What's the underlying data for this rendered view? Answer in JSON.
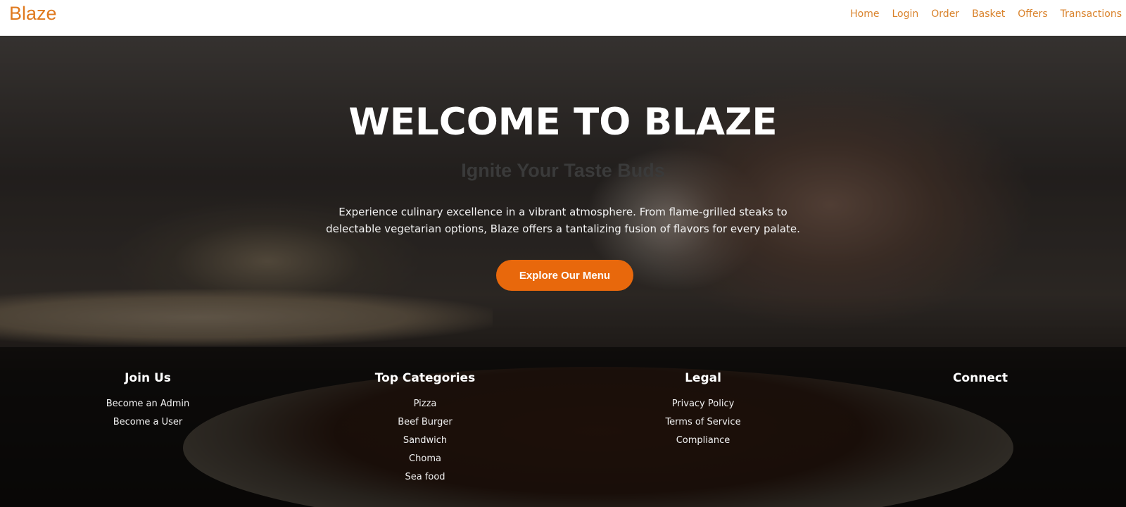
{
  "header": {
    "brand": "Blaze",
    "nav": [
      "Home",
      "Login",
      "Order",
      "Basket",
      "Offers",
      "Transactions"
    ]
  },
  "hero": {
    "title": "WELCOME TO BLAZE",
    "subtitle": "Ignite Your Taste Buds",
    "description": "Experience culinary excellence in a vibrant atmosphere. From flame-grilled steaks to delectable vegetarian options, Blaze offers a tantalizing fusion of flavors for every palate.",
    "cta": "Explore Our Menu"
  },
  "footer": {
    "join": {
      "heading": "Join Us",
      "links": [
        "Become an Admin",
        "Become a User"
      ]
    },
    "categories": {
      "heading": "Top Categories",
      "links": [
        "Pizza",
        "Beef Burger",
        "Sandwich",
        "Choma",
        "Sea food"
      ]
    },
    "legal": {
      "heading": "Legal",
      "links": [
        "Privacy Policy",
        "Terms of Service",
        "Compliance"
      ]
    },
    "connect": {
      "heading": "Connect"
    }
  },
  "colors": {
    "brand": "#e07a1f",
    "nav": "#d9822b",
    "cta": "#e8680c"
  }
}
